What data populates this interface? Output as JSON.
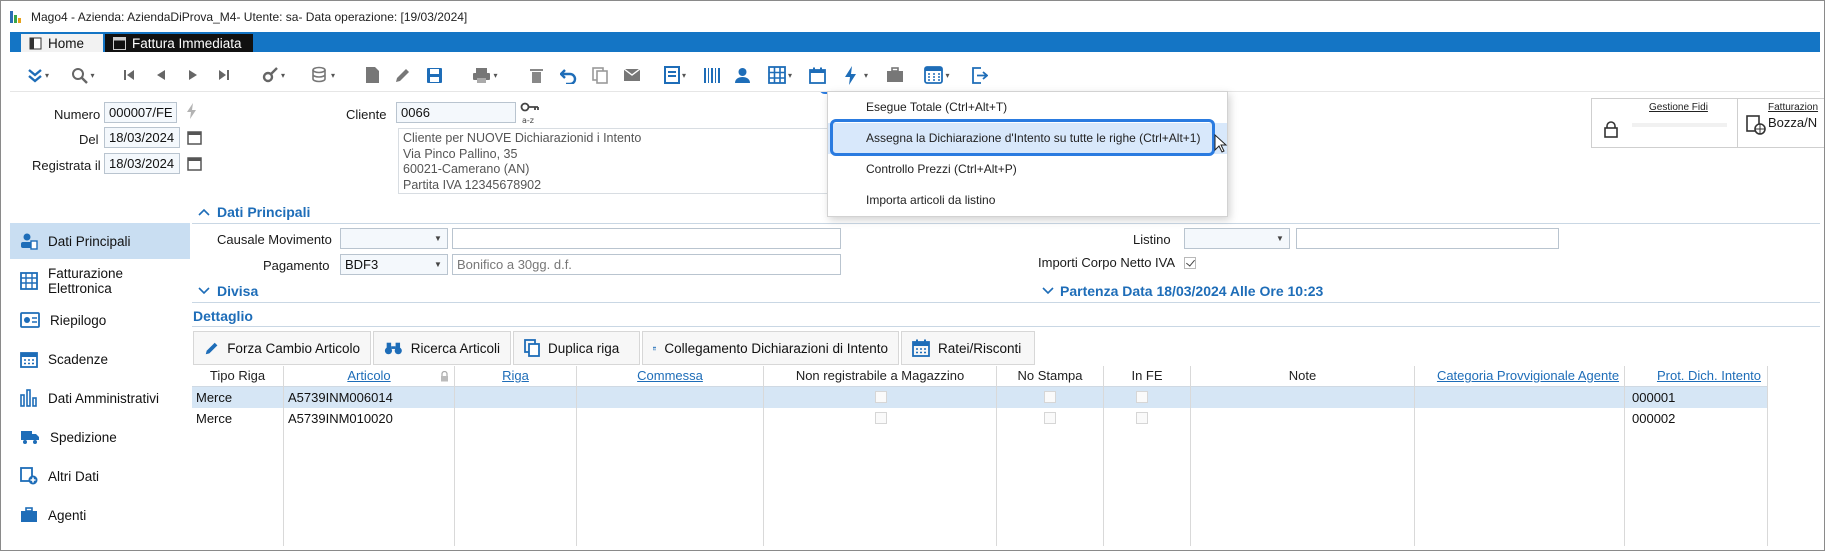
{
  "window": {
    "title": "Mago4 - Azienda: AziendaDiProva_M4- Utente: sa- Data operazione: [19/03/2024]"
  },
  "tabs": [
    {
      "label": "Home"
    },
    {
      "label": "Fattura Immediata"
    }
  ],
  "toolbar_icons": [
    "expand-icon",
    "search-icon",
    "first-record-icon",
    "previous-record-icon",
    "next-record-icon",
    "last-record-icon",
    "tools-icon",
    "database-icon",
    "new-document-icon",
    "edit-icon",
    "save-icon",
    "print-icon",
    "delete-icon",
    "undo-icon",
    "copy-icon",
    "email-icon",
    "report-icon",
    "barcode-icon",
    "contact-icon",
    "grid-icon",
    "calendar-icon",
    "lightning-icon",
    "briefcase-icon",
    "calculator-icon",
    "exit-icon"
  ],
  "header": {
    "numero_label": "Numero",
    "numero_value": "000007/FE",
    "del_label": "Del",
    "del_value": "18/03/2024",
    "registrata_label": "Registrata il",
    "registrata_value": "18/03/2024",
    "cliente_label": "Cliente",
    "cliente_value": "0066",
    "address_lines": [
      "Cliente per NUOVE Dichiarazionid i Intento",
      "Via Pinco Pallino, 35",
      "60021-Camerano (AN)",
      "Partita IVA 12345678902"
    ]
  },
  "menu": {
    "items": [
      {
        "label": "Esegue Totale (Ctrl+Alt+T)"
      },
      {
        "label": "Assegna la Dichiarazione d'Intento su tutte le righe (Ctrl+Alt+1)"
      },
      {
        "label": "Controllo Prezzi (Ctrl+Alt+P)"
      },
      {
        "label": "Importa articoli da listino"
      }
    ]
  },
  "cards": {
    "gestione_fidi": "Gestione Fidi",
    "fatturazione_title": "Fatturazion",
    "fatturazione_value": "Bozza/N"
  },
  "sidebar": {
    "items": [
      {
        "label": "Dati Principali",
        "icon": "person-card-icon"
      },
      {
        "label": "Fatturazione Elettronica",
        "icon": "invoice-grid-icon"
      },
      {
        "label": "Riepilogo",
        "icon": "summary-icon"
      },
      {
        "label": "Scadenze",
        "icon": "calendar-icon"
      },
      {
        "label": "Dati Amministrativi",
        "icon": "bar-chart-icon"
      },
      {
        "label": "Spedizione",
        "icon": "truck-icon"
      },
      {
        "label": "Altri Dati",
        "icon": "add-document-icon"
      },
      {
        "label": "Agenti",
        "icon": "briefcase-icon"
      }
    ]
  },
  "sections": {
    "dati_principali": "Dati Principali",
    "divisa": "Divisa",
    "partenza": "Partenza Data 18/03/2024 Alle Ore 10:23",
    "dettaglio": "Dettaglio"
  },
  "form": {
    "causale_label": "Causale Movimento",
    "causale_value": "",
    "causale_desc": "",
    "pagamento_label": "Pagamento",
    "pagamento_value": "BDF3",
    "pagamento_desc": "Bonifico a 30gg. d.f.",
    "listino_label": "Listino",
    "listino_value": "",
    "listino_desc": "",
    "importi_label": "Importi Corpo Netto IVA",
    "importi_checked": true
  },
  "detail_toolbar": [
    {
      "label": "Forza Cambio Articolo",
      "icon": "pencil-icon"
    },
    {
      "label": "Ricerca Articoli",
      "icon": "binoculars-icon"
    },
    {
      "label": "Duplica riga",
      "icon": "duplicate-icon"
    },
    {
      "label": "Collegamento Dichiarazioni di Intento",
      "icon": "link-table-icon"
    },
    {
      "label": "Ratei/Risconti",
      "icon": "calendar-icon"
    }
  ],
  "grid": {
    "columns": [
      "Tipo Riga",
      "Articolo",
      "Riga",
      "Commessa",
      "Non registrabile a Magazzino",
      "No Stampa",
      "In FE",
      "Note",
      "Categoria Provvigionale Agente",
      "Prot. Dich. Intento"
    ],
    "rows": [
      [
        "Merce",
        "A5739INM006014",
        "",
        "",
        "",
        "",
        "",
        "",
        "",
        "000001"
      ],
      [
        "Merce",
        "A5739INM010020",
        "",
        "",
        "",
        "",
        "",
        "",
        "",
        "000002"
      ]
    ]
  },
  "colors": {
    "accent_blue": "#1475c5",
    "highlight_border": "#2a7be0",
    "link_blue": "#1e6db8",
    "selected_row": "#d6e6f5"
  }
}
